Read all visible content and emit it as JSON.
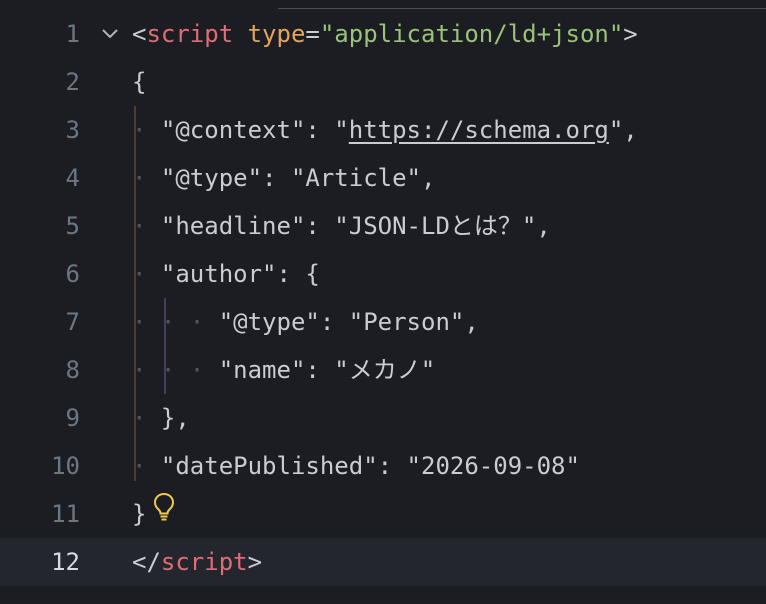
{
  "editor": {
    "lines": [
      {
        "number": "1",
        "segments": [
          {
            "cls": "plain",
            "text": "<"
          },
          {
            "cls": "tag",
            "text": "script"
          },
          {
            "cls": "plain",
            "text": " "
          },
          {
            "cls": "attr",
            "text": "type"
          },
          {
            "cls": "plain",
            "text": "="
          },
          {
            "cls": "str",
            "text": "\"application/ld+json\""
          },
          {
            "cls": "plain",
            "text": ">"
          }
        ]
      },
      {
        "number": "2",
        "segments": [
          {
            "cls": "plain",
            "text": "{"
          }
        ]
      },
      {
        "number": "3",
        "segments": [
          {
            "cls": "ws",
            "text": "· "
          },
          {
            "cls": "plain",
            "text": "\"@context\": \""
          },
          {
            "cls": "plain link",
            "text": "https://schema.org"
          },
          {
            "cls": "plain",
            "text": "\","
          }
        ]
      },
      {
        "number": "4",
        "segments": [
          {
            "cls": "ws",
            "text": "· "
          },
          {
            "cls": "plain",
            "text": "\"@type\": \"Article\","
          }
        ]
      },
      {
        "number": "5",
        "segments": [
          {
            "cls": "ws",
            "text": "· "
          },
          {
            "cls": "plain",
            "text": "\"headline\": \"JSON-LDとは？\","
          }
        ]
      },
      {
        "number": "6",
        "segments": [
          {
            "cls": "ws",
            "text": "· "
          },
          {
            "cls": "plain",
            "text": "\"author\": {"
          }
        ]
      },
      {
        "number": "7",
        "segments": [
          {
            "cls": "ws",
            "text": "· · · "
          },
          {
            "cls": "plain",
            "text": "\"@type\": \"Person\","
          }
        ]
      },
      {
        "number": "8",
        "segments": [
          {
            "cls": "ws",
            "text": "· · · "
          },
          {
            "cls": "plain",
            "text": "\"name\": \"メカノ\""
          }
        ]
      },
      {
        "number": "9",
        "segments": [
          {
            "cls": "ws",
            "text": "· "
          },
          {
            "cls": "plain",
            "text": "},"
          }
        ]
      },
      {
        "number": "10",
        "segments": [
          {
            "cls": "ws",
            "text": "· "
          },
          {
            "cls": "plain",
            "text": "\"datePublished\": \"2026-09-08\""
          }
        ]
      },
      {
        "number": "11",
        "segments": [
          {
            "cls": "plain",
            "text": "}"
          }
        ]
      },
      {
        "number": "12",
        "segments": [
          {
            "cls": "plain",
            "text": "</"
          },
          {
            "cls": "tag",
            "text": "script"
          },
          {
            "cls": "plain",
            "text": ">"
          }
        ]
      }
    ],
    "current_line": "12",
    "fold_icon": "chevron-down-icon",
    "hint_icon": "lightbulb-icon",
    "colors": {
      "tag": "#e06c75",
      "attribute": "#e5a45a",
      "string": "#98c379",
      "bulb": "#f2c94c"
    }
  }
}
